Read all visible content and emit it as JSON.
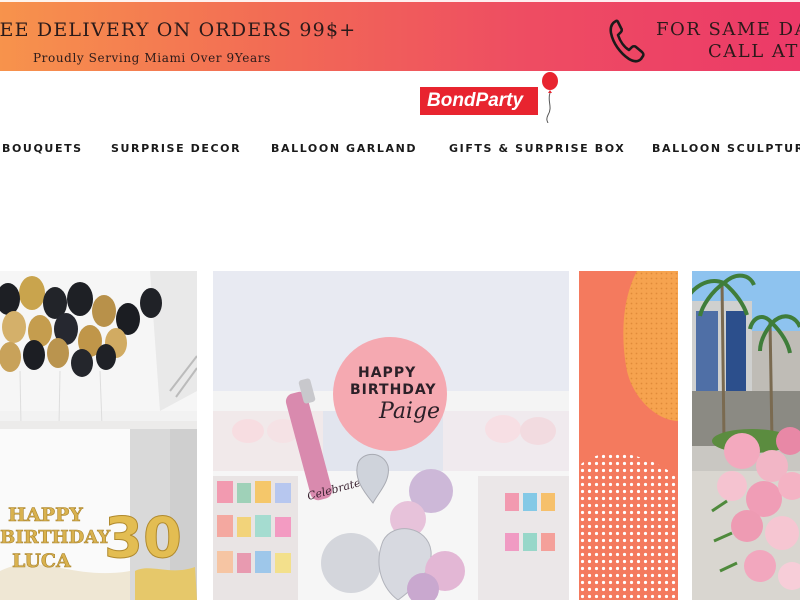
{
  "banner": {
    "promo": "REE DELIVERY ON ORDERS 99$+",
    "subline": "Proudly Serving Miami Over 9Years",
    "cta_line1": "FOR SAME DA",
    "cta_line2": "CALL AT",
    "phone_icon": "phone-icon"
  },
  "logo": {
    "text": "BondParty"
  },
  "nav": {
    "items": [
      "BOUQUETS",
      "SURPRISE DECOR",
      "BALLOON GARLAND",
      "GIFTS & SURPRISE BOX",
      "BALLOON SCULPTUR"
    ]
  },
  "gallery": {
    "card1": {
      "sign_line1": "HAPPY",
      "sign_line2": "BIRTHDAY",
      "sign_line3": "LUCA",
      "number": "30"
    },
    "card2": {
      "balloon_line1": "HAPPY",
      "balloon_line2": "BIRTHDAY",
      "balloon_line3": "Paige",
      "bottle_label": "Celebrate"
    }
  },
  "colors": {
    "banner_start": "#f7934c",
    "banner_end": "#ec3a68",
    "logo_red": "#e8242f",
    "text_dark": "#1a1a1a"
  }
}
